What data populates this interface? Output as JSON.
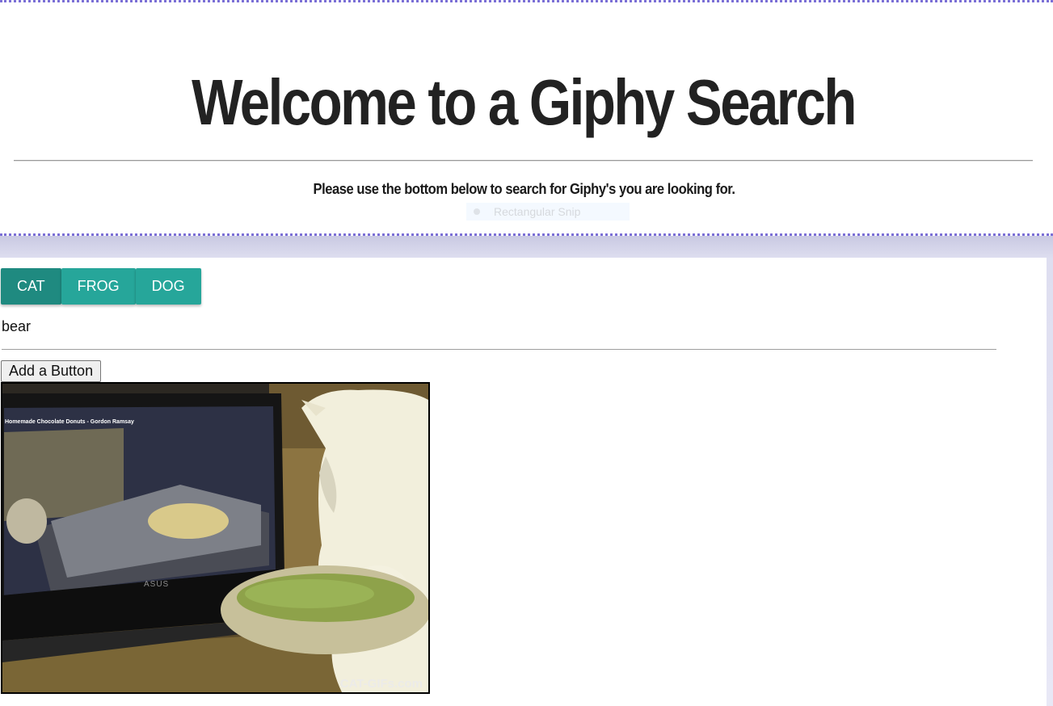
{
  "header": {
    "title": "Welcome to a Giphy Search",
    "subtitle": "Please use the bottom below to search for Giphy's you are looking for.",
    "snip_overlay": "Rectangular Snip"
  },
  "buttons": [
    {
      "label": "CAT",
      "active": true
    },
    {
      "label": "FROG",
      "active": false
    },
    {
      "label": "DOG",
      "active": false
    }
  ],
  "search_input": {
    "value": "bear"
  },
  "add_button": {
    "label": "Add a Button"
  },
  "gif": {
    "video_title": "Homemade Chocolate Donuts - Gordon Ramsay",
    "laptop_brand": "ASUS",
    "watermark": "CAT-GIFs.com"
  },
  "colors": {
    "accent_dotted_border": "#7b6fd6",
    "button_teal": "#26a69a",
    "button_teal_active": "#1f8a80"
  }
}
